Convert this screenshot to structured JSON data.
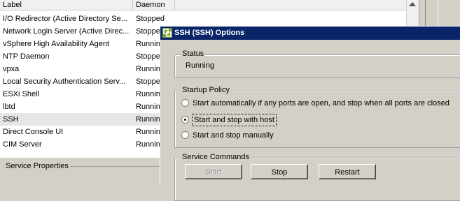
{
  "list": {
    "columns": [
      "Label",
      "Daemon"
    ],
    "rows": [
      {
        "label": "I/O Redirector (Active Directory Se...",
        "daemon": "Stopped"
      },
      {
        "label": "Network Login Server (Active Direc...",
        "daemon": "Stopped"
      },
      {
        "label": "vSphere High Availability Agent",
        "daemon": "Running"
      },
      {
        "label": "NTP Daemon",
        "daemon": "Stopped"
      },
      {
        "label": "vpxa",
        "daemon": "Running"
      },
      {
        "label": "Local Security Authentication Serv...",
        "daemon": "Stopped"
      },
      {
        "label": "ESXi Shell",
        "daemon": "Running"
      },
      {
        "label": "lbtd",
        "daemon": "Running"
      },
      {
        "label": "SSH",
        "daemon": "Running"
      },
      {
        "label": "Direct Console UI",
        "daemon": "Running"
      },
      {
        "label": "CIM Server",
        "daemon": "Running"
      }
    ]
  },
  "service_properties": {
    "title": "Service Properties"
  },
  "dialog": {
    "title": "SSH (SSH) Options",
    "status": {
      "legend": "Status",
      "value": "Running"
    },
    "startup": {
      "legend": "Startup Policy",
      "options": [
        "Start automatically if any ports are open, and stop when all ports are closed",
        "Start and stop with host",
        "Start and stop manually"
      ],
      "selected": 1
    },
    "commands": {
      "legend": "Service Commands",
      "start": "Start",
      "stop": "Stop",
      "restart": "Restart"
    }
  },
  "colors": {
    "title_bar": "#0a246a",
    "dialog_bg": "#d4d0c8"
  }
}
